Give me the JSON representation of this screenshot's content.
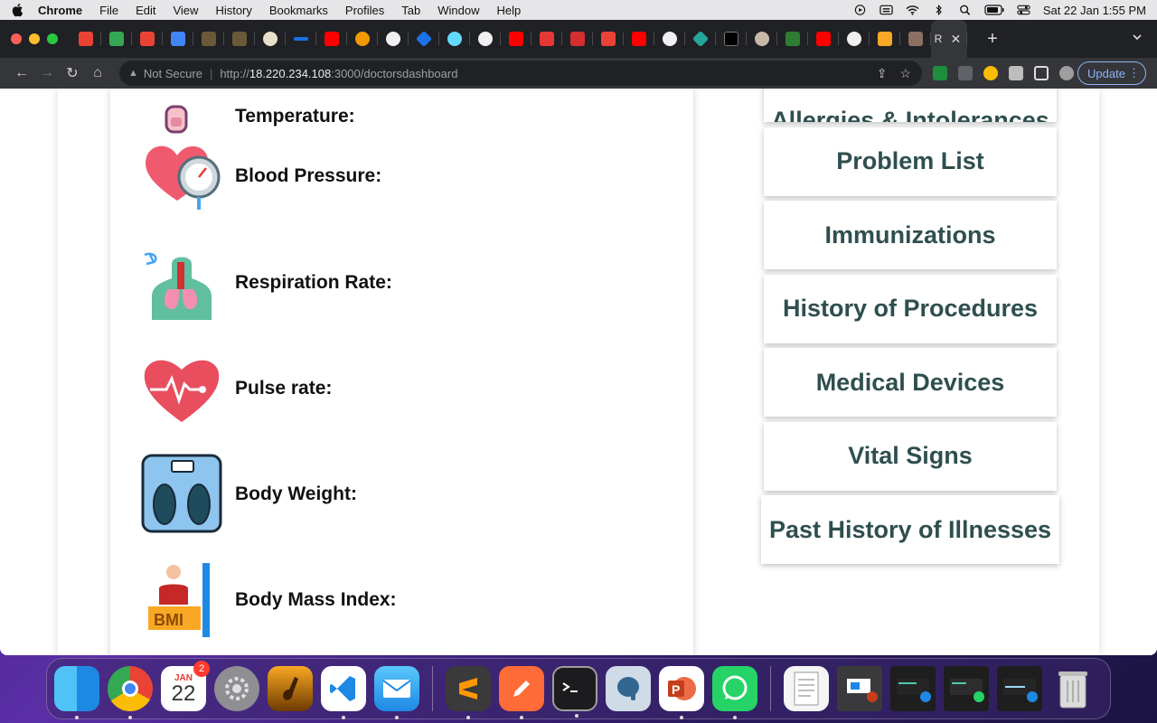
{
  "menubar": {
    "app_name": "Chrome",
    "items": [
      "File",
      "Edit",
      "View",
      "History",
      "Bookmarks",
      "Profiles",
      "Tab",
      "Window",
      "Help"
    ],
    "datetime": "Sat 22 Jan  1:55 PM"
  },
  "browser": {
    "active_tab_title": "R",
    "url_security": "Not Secure",
    "url_scheme": "http://",
    "url_host": "18.220.234.108",
    "url_path": ":3000/doctorsdashboard",
    "update_label": "Update"
  },
  "vitals": [
    {
      "label": "Temperature:",
      "icon": "thermometer-hand-icon"
    },
    {
      "label": "Blood Pressure:",
      "icon": "blood-pressure-heart-icon"
    },
    {
      "label": "Respiration Rate:",
      "icon": "lungs-respiration-icon"
    },
    {
      "label": "Pulse rate:",
      "icon": "heart-pulse-icon"
    },
    {
      "label": "Body Weight:",
      "icon": "weight-scale-icon"
    },
    {
      "label": "Body Mass Index:",
      "icon": "bmi-person-icon"
    }
  ],
  "sidebar": {
    "items": [
      {
        "label": "Allergies & Intolerances"
      },
      {
        "label": "Problem List"
      },
      {
        "label": "Immunizations"
      },
      {
        "label": "History of Procedures"
      },
      {
        "label": "Medical Devices"
      },
      {
        "label": "Vital Signs"
      },
      {
        "label": "Past History of Illnesses"
      }
    ]
  },
  "dock": {
    "calendar_month": "JAN",
    "calendar_day": "22",
    "calendar_badge": "2"
  },
  "colors": {
    "sidebar_text": "#2f4f4f",
    "tabstrip_bg": "#202124",
    "toolbar_bg": "#35363a"
  }
}
